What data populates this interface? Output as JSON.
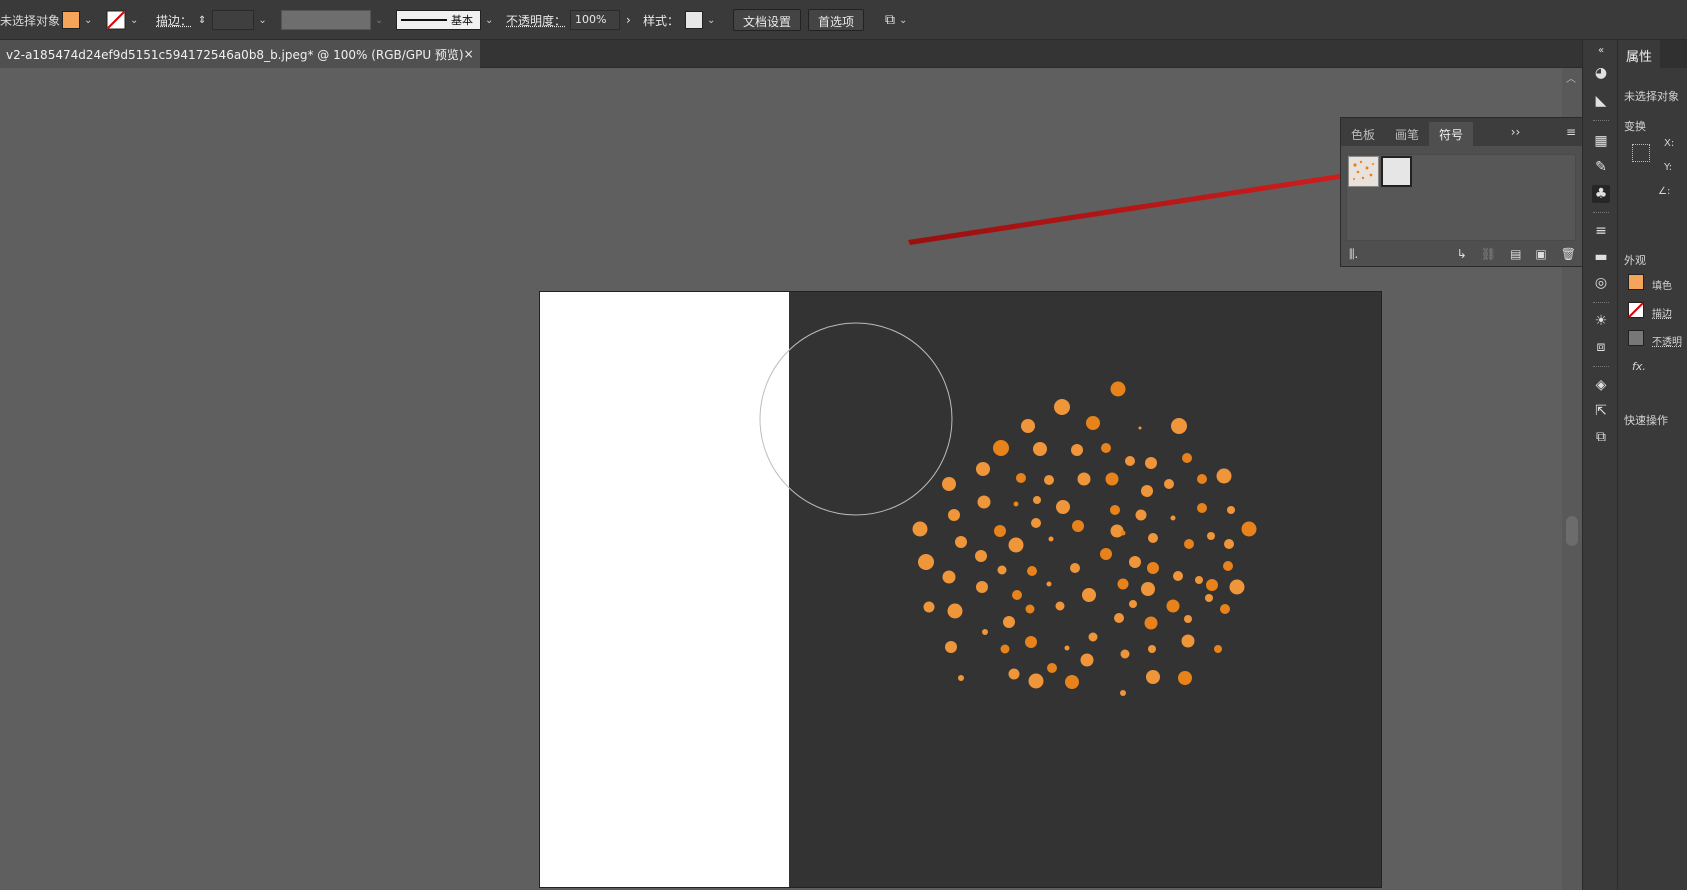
{
  "control_bar": {
    "selection_label": "未选择对象",
    "stroke_label": "描边：",
    "brush_label": "基本",
    "opacity_label": "不透明度：",
    "opacity_value": "100%",
    "style_label": "样式：",
    "doc_setup_button": "文档设置",
    "preferences_button": "首选项",
    "fill_color": "#f5a55a"
  },
  "document_tab": {
    "title": "v2-a185474d24ef9d5151c594172546a0b8_b.jpeg* @ 100% (RGB/GPU 预览)",
    "close": "×"
  },
  "symbols_panel": {
    "tabs": [
      "色板",
      "画笔",
      "符号"
    ],
    "active_tab": "符号",
    "expand": "››"
  },
  "properties_panel": {
    "title": "属性",
    "no_selection": "未选择对象",
    "transform": "变换",
    "x_label": "X:",
    "y_label": "Y:",
    "angle_label": "∠:",
    "appearance": "外观",
    "fill": "填色",
    "stroke": "描边",
    "opacity": "不透明",
    "fx": "fx.",
    "quick_actions": "快速操作"
  },
  "artwork": {
    "dot_color": "#e8821a",
    "dot_color_light": "#f0963a"
  }
}
